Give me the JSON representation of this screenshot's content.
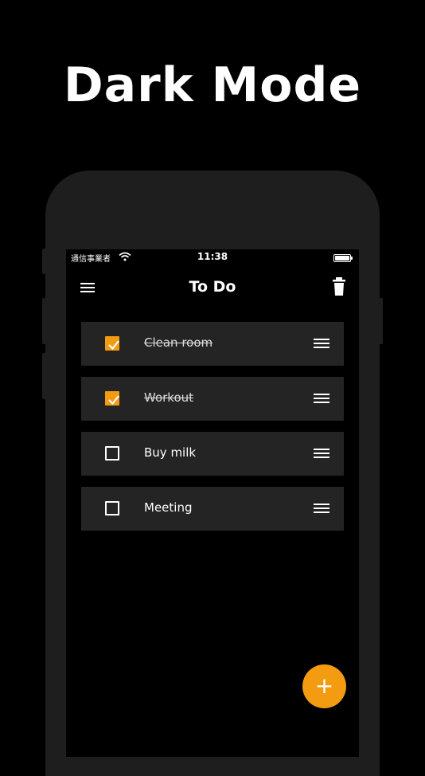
{
  "headline": "Dark Mode",
  "status_bar": {
    "carrier": "通信事業者",
    "time": "11:38",
    "wifi_icon": "wifi-icon",
    "battery_icon": "battery-icon"
  },
  "nav": {
    "title": "To Do",
    "menu_icon": "hamburger-menu-icon",
    "delete_icon": "trash-icon"
  },
  "todos": [
    {
      "label": "Clean room",
      "checked": true
    },
    {
      "label": "Workout",
      "checked": true
    },
    {
      "label": "Buy milk",
      "checked": false
    },
    {
      "label": "Meeting",
      "checked": false
    }
  ],
  "fab": {
    "label": "+"
  },
  "colors": {
    "background": "#000000",
    "phone_frame": "#1e1e1e",
    "card": "#242424",
    "accent": "#f39c12",
    "text": "#ffffff"
  }
}
